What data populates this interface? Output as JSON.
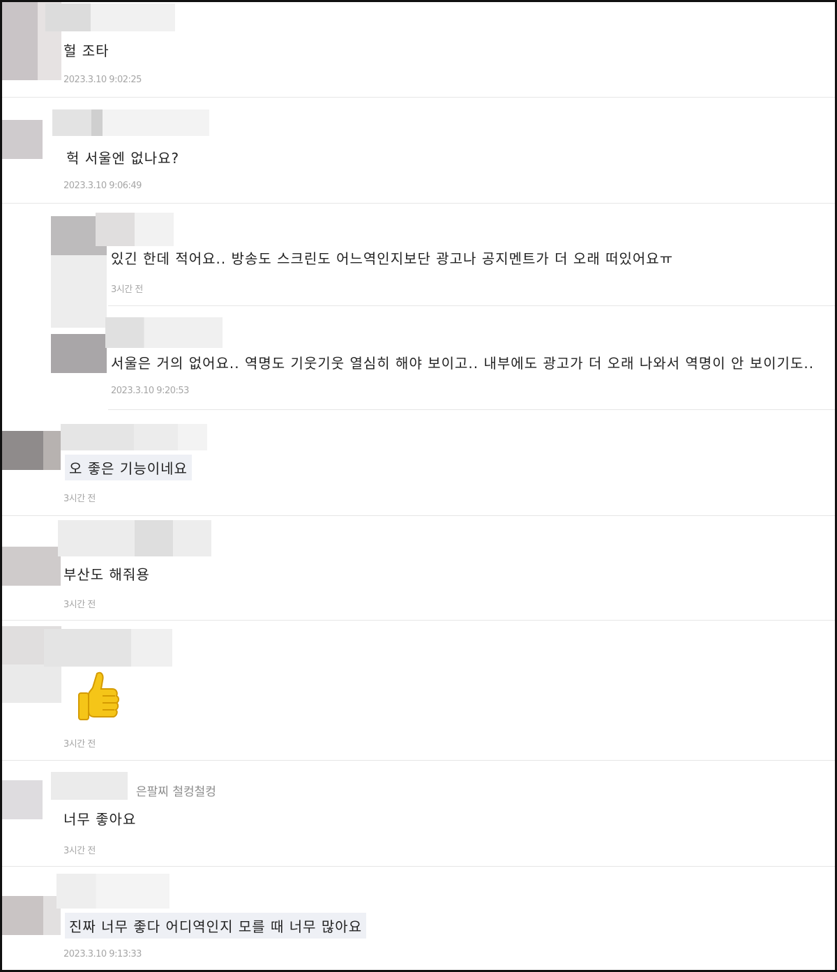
{
  "comments": [
    {
      "text": "헐 조타",
      "time": "2023.3.10 9:02:25"
    },
    {
      "text": "헉 서울엔 없나요?",
      "time": "2023.3.10 9:06:49"
    },
    {
      "text": "있긴 한데 적어요.. 방송도 스크린도 어느역인지보단 광고나 공지멘트가 더 오래 떠있어요ㅠ",
      "time": "3시간 전"
    },
    {
      "text": "서울은 거의 없어요.. 역명도 기웃기웃 열심히 해야 보이고.. 내부에도 광고가 더 오래 나와서 역명이 안 보이기도..",
      "time": "2023.3.10 9:20:53"
    },
    {
      "text": "오 좋은 기능이네요",
      "time": "3시간 전"
    },
    {
      "text": "부산도 해줘용",
      "time": "3시간 전"
    },
    {
      "emoji": "thumbs-up-icon",
      "time": "3시간 전"
    },
    {
      "text": "너무 좋아요",
      "tag": "은팔찌 철컹철컹",
      "time": "3시간 전"
    },
    {
      "text": "진짜 너무 좋다 어디역인지 모를 때 너무 많아요",
      "time": "2023.3.10 9:13:33"
    }
  ],
  "colors": {
    "emoji_yellow": "#f5c518",
    "emoji_outline": "#d49a00"
  }
}
